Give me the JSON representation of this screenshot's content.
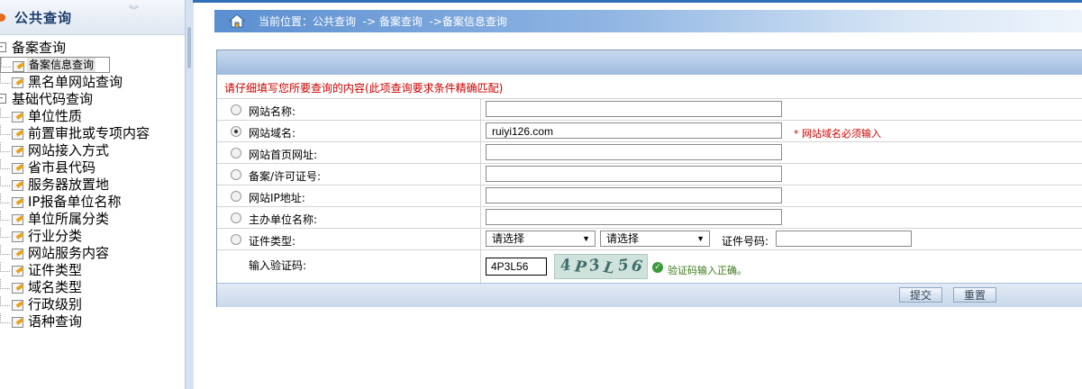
{
  "sidebar": {
    "title": "公共查询",
    "tree": [
      {
        "label": "备案查询",
        "children": [
          "备案信息查询",
          "黑名单网站查询"
        ]
      },
      {
        "label": "基础代码查询",
        "children": [
          "单位性质",
          "前置审批或专项内容",
          "网站接入方式",
          "省市县代码",
          "服务器放置地",
          "IP报备单位名称",
          "单位所属分类",
          "行业分类",
          "网站服务内容",
          "证件类型",
          "域名类型",
          "行政级别",
          "语种查询"
        ]
      }
    ],
    "selected": "备案信息查询"
  },
  "breadcrumb": {
    "text": "当前位置：公共查询  -> 备案查询  ->备案信息查询"
  },
  "form": {
    "notice": "请仔细填写您所要查询的内容(此项查询要求条件精确匹配)",
    "fields": [
      {
        "label": "网站名称:",
        "value": "",
        "selected": false
      },
      {
        "label": "网站域名:",
        "value": "ruiyi126.com",
        "selected": true
      },
      {
        "label": "网站首页网址:",
        "value": "",
        "selected": false
      },
      {
        "label": "备案/许可证号:",
        "value": "",
        "selected": false
      },
      {
        "label": "网站IP地址:",
        "value": "",
        "selected": false
      },
      {
        "label": "主办单位名称:",
        "value": "",
        "selected": false
      }
    ],
    "domain_required": "* 网站域名必须输入",
    "cert": {
      "label": "证件类型:",
      "select1": "请选择",
      "select2": "请选择",
      "number_label": "证件号码:",
      "number_value": ""
    },
    "captcha": {
      "label": "输入验证码:",
      "value": "4P3L56",
      "image_chars": [
        "4",
        "P",
        "3",
        "L",
        "5",
        "6"
      ],
      "ok_text": "验证码输入正确。"
    },
    "buttons": {
      "submit": "提交",
      "reset": "重置"
    }
  },
  "colors": {
    "accent": "#2f6fb7",
    "error": "#cc0000",
    "ok": "#3a7a1a"
  }
}
